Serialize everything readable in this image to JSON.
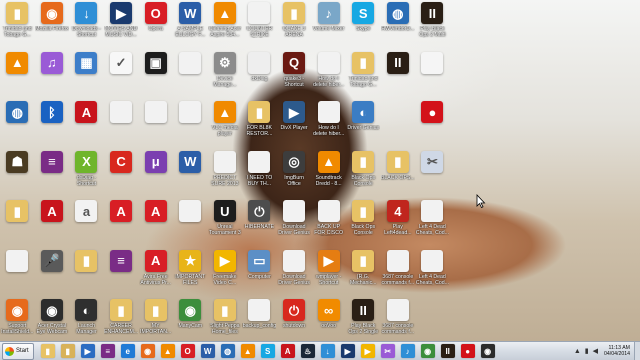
{
  "desktop": {
    "icons": [
      {
        "label": "Trinidad and Tobago G...",
        "icon": "folder-icon",
        "color": "#e7c265",
        "glyph": "▮"
      },
      {
        "label": "Mozilla Firefox",
        "icon": "firefox-icon",
        "color": "#e66a1c",
        "glyph": "◉"
      },
      {
        "label": "Downloads - Shortcut",
        "icon": "downloads-icon",
        "color": "#2f8fd6",
        "glyph": "↓"
      },
      {
        "label": "MOVIES AND MUSIC VID...",
        "icon": "media-center-icon",
        "color": "#1a3a6e",
        "glyph": "▶"
      },
      {
        "label": "Opera",
        "icon": "opera-icon",
        "color": "#d81e25",
        "glyph": "O"
      },
      {
        "label": "A SAMPLE EULOGY F...",
        "icon": "word-doc-icon",
        "color": "#2b5ea8",
        "glyph": "W"
      },
      {
        "label": "Cleaning Acer Aspire 534...",
        "icon": "vlc-icon",
        "color": "#f08a00",
        "glyph": "▲"
      },
      {
        "label": "COUNTER STRIKE GLO...",
        "icon": "file-icon",
        "color": "#f2f2f2",
        "glyph": ""
      },
      {
        "label": "QUAKE 3 ARENA",
        "icon": "folder-icon",
        "color": "#e7c265",
        "glyph": "▮"
      },
      {
        "label": "Volume Mixer",
        "icon": "volume-mixer-icon",
        "color": "#7aa7c8",
        "glyph": "♪"
      },
      {
        "label": "Skype",
        "icon": "skype-icon",
        "color": "#17a8e3",
        "glyph": "S"
      },
      {
        "label": "HWVendorD...",
        "icon": "globe-icon",
        "color": "#2a6db5",
        "glyph": "◍"
      },
      {
        "label": "Play Black Ops 2 Multi",
        "icon": "black-ops-icon",
        "color": "#2a1f15",
        "glyph": "II"
      },
      {
        "label": "",
        "icon": "",
        "color": "",
        "glyph": ""
      },
      {
        "label": "",
        "icon": "",
        "color": "",
        "glyph": ""
      },
      {
        "label": "",
        "icon": "vlc-icon",
        "color": "#f08a00",
        "glyph": "▲"
      },
      {
        "label": "",
        "icon": "itunes-icon",
        "color": "#9a5bd6",
        "glyph": "♫"
      },
      {
        "label": "",
        "icon": "control-panel-icon",
        "color": "#3d7ec9",
        "glyph": "▦"
      },
      {
        "label": "",
        "icon": "checkmark-icon",
        "color": "#f7f7f7",
        "glyph": "✓"
      },
      {
        "label": "",
        "icon": "app-icon",
        "color": "#1d1d1d",
        "glyph": "▣"
      },
      {
        "label": "",
        "icon": "file-icon",
        "color": "#f2f2f2",
        "glyph": ""
      },
      {
        "label": "Device Manage...",
        "icon": "device-manager-icon",
        "color": "#8c8c8c",
        "glyph": "⚙"
      },
      {
        "label": "dxDiag",
        "icon": "file-icon",
        "color": "#eeeeee",
        "glyph": ""
      },
      {
        "label": "quake3 - Shortcut",
        "icon": "quake-icon",
        "color": "#6b1a12",
        "glyph": "Q"
      },
      {
        "label": "How do I delete hiber...",
        "icon": "file-icon",
        "color": "#f2f2f2",
        "glyph": ""
      },
      {
        "label": "Trinidad and Tobago G...",
        "icon": "folder-icon",
        "color": "#e7c265",
        "glyph": "▮"
      },
      {
        "label": "",
        "icon": "black-ops-icon",
        "color": "#2a1f15",
        "glyph": "II"
      },
      {
        "label": "",
        "icon": "file-icon",
        "color": "#f5f5f5",
        "glyph": ""
      },
      {
        "label": "",
        "icon": "",
        "color": "",
        "glyph": ""
      },
      {
        "label": "",
        "icon": "",
        "color": "",
        "glyph": ""
      },
      {
        "label": "",
        "icon": "globe-icon",
        "color": "#2a6db5",
        "glyph": "◍"
      },
      {
        "label": "",
        "icon": "bluetooth-icon",
        "color": "#1a62c2",
        "glyph": "ᛒ"
      },
      {
        "label": "",
        "icon": "pdf-icon",
        "color": "#c8141c",
        "glyph": "A"
      },
      {
        "label": "",
        "icon": "file-icon",
        "color": "#f2f2f2",
        "glyph": ""
      },
      {
        "label": "",
        "icon": "file-icon",
        "color": "#f2f2f2",
        "glyph": ""
      },
      {
        "label": "",
        "icon": "file-icon",
        "color": "#f2f2f2",
        "glyph": ""
      },
      {
        "label": "VLC media player",
        "icon": "vlc-icon",
        "color": "#f08a00",
        "glyph": "▲"
      },
      {
        "label": "FOR BL8K RESTOR...",
        "icon": "folder-icon",
        "color": "#e7c265",
        "glyph": "▮"
      },
      {
        "label": "DivX Player",
        "icon": "divx-icon",
        "color": "#2d5a8c",
        "glyph": "▶"
      },
      {
        "label": "How do I delete hiber...",
        "icon": "file-icon",
        "color": "#f2f2f2",
        "glyph": ""
      },
      {
        "label": "Driver Genius",
        "icon": "driver-genius-icon",
        "color": "#3b7dc4",
        "glyph": "◐"
      },
      {
        "label": "",
        "icon": "",
        "color": "",
        "glyph": ""
      },
      {
        "label": "",
        "icon": "record-icon",
        "color": "#d3121a",
        "glyph": "●"
      },
      {
        "label": "",
        "icon": "",
        "color": "",
        "glyph": ""
      },
      {
        "label": "",
        "icon": "",
        "color": "",
        "glyph": ""
      },
      {
        "label": "",
        "icon": "game-icon",
        "color": "#4a3b22",
        "glyph": "☗"
      },
      {
        "label": "",
        "icon": "winrar-icon",
        "color": "#7a2c86",
        "glyph": "≡"
      },
      {
        "label": "dxDiag - Shortcut",
        "icon": "xbox-icon",
        "color": "#6fb52c",
        "glyph": "X"
      },
      {
        "label": "",
        "icon": "ccleaner-icon",
        "color": "#d8281e",
        "glyph": "C"
      },
      {
        "label": "",
        "icon": "bittorrent-icon",
        "color": "#7b3fb0",
        "glyph": "μ"
      },
      {
        "label": "",
        "icon": "word-doc-icon",
        "color": "#2b5ea8",
        "glyph": "W"
      },
      {
        "label": "PREDICT SURE 2013",
        "icon": "file-icon",
        "color": "#f2f2f2",
        "glyph": ""
      },
      {
        "label": "I NEED TO BUY TH...",
        "icon": "file-icon",
        "color": "#f2f2f2",
        "glyph": ""
      },
      {
        "label": "ImgBurn Office",
        "icon": "imgburn-icon",
        "color": "#3d3d3d",
        "glyph": "◎"
      },
      {
        "label": "Soundtrack Dredd - 8...",
        "icon": "vlc-icon",
        "color": "#f08a00",
        "glyph": "▲"
      },
      {
        "label": "Black Ops Console Che...",
        "icon": "folder-icon",
        "color": "#e7c265",
        "glyph": "▮"
      },
      {
        "label": "BLACK OPS...",
        "icon": "folder-icon",
        "color": "#e7c265",
        "glyph": "▮"
      },
      {
        "label": "",
        "icon": "snipping-tool-icon",
        "color": "#cfd8e6",
        "glyph": "✂"
      },
      {
        "label": "",
        "icon": "",
        "color": "",
        "glyph": ""
      },
      {
        "label": "",
        "icon": "",
        "color": "",
        "glyph": ""
      },
      {
        "label": "",
        "icon": "folder-icon",
        "color": "#e7c265",
        "glyph": "▮"
      },
      {
        "label": "",
        "icon": "pdf-icon",
        "color": "#c8141c",
        "glyph": "A"
      },
      {
        "label": "",
        "icon": "file-icon",
        "color": "#f2f2f2",
        "glyph": "a"
      },
      {
        "label": "",
        "icon": "avira-icon",
        "color": "#d81e25",
        "glyph": "A"
      },
      {
        "label": "",
        "icon": "avira-icon",
        "color": "#d81e25",
        "glyph": "A"
      },
      {
        "label": "",
        "icon": "file-icon",
        "color": "#f2f2f2",
        "glyph": ""
      },
      {
        "label": "Unreal Tournament 3",
        "icon": "unreal-icon",
        "color": "#1d1d1d",
        "glyph": "U"
      },
      {
        "label": "HIBERNATE",
        "icon": "power-icon",
        "color": "#4d4d4d",
        "glyph": "⏻"
      },
      {
        "label": "Download Driver Genius",
        "icon": "file-icon",
        "color": "#f2f2f2",
        "glyph": ""
      },
      {
        "label": "BACK UP FOR CISCO ROU...",
        "icon": "file-icon",
        "color": "#f2f2f2",
        "glyph": ""
      },
      {
        "label": "Black Ops Console Che...",
        "icon": "folder-icon",
        "color": "#e7c265",
        "glyph": "▮"
      },
      {
        "label": "Play Left4dead...",
        "icon": "left4dead-icon",
        "color": "#c0261e",
        "glyph": "4"
      },
      {
        "label": "Left 4 Dead Cheats, Cod...",
        "icon": "file-icon",
        "color": "#f2f2f2",
        "glyph": ""
      },
      {
        "label": "",
        "icon": "",
        "color": "",
        "glyph": ""
      },
      {
        "label": "",
        "icon": "",
        "color": "",
        "glyph": ""
      },
      {
        "label": "",
        "icon": "file-icon",
        "color": "#f2f2f2",
        "glyph": ""
      },
      {
        "label": "",
        "icon": "microphone-icon",
        "color": "#5a5a5a",
        "glyph": "🎤"
      },
      {
        "label": "",
        "icon": "folder-icon",
        "color": "#e7c265",
        "glyph": "▮"
      },
      {
        "label": "",
        "icon": "winrar-icon",
        "color": "#7a2c86",
        "glyph": "≡"
      },
      {
        "label": "Avira Free Antivirus Pr...",
        "icon": "avira-icon",
        "color": "#d81e25",
        "glyph": "A"
      },
      {
        "label": "IMPORTANT FILES",
        "icon": "star-icon",
        "color": "#e8b419",
        "glyph": "★"
      },
      {
        "label": "Freemake Video C...",
        "icon": "freemake-icon",
        "color": "#f2b600",
        "glyph": "▶"
      },
      {
        "label": "Computer",
        "icon": "computer-icon",
        "color": "#5c8fc6",
        "glyph": "▭"
      },
      {
        "label": "Download Driver Genius",
        "icon": "file-icon",
        "color": "#f2f2f2",
        "glyph": ""
      },
      {
        "label": "wmplayer - Shortcut",
        "icon": "wmplayer-icon",
        "color": "#e57d12",
        "glyph": "▶"
      },
      {
        "label": "[R.G. Mechanic...",
        "icon": "folder-icon",
        "color": "#e7c265",
        "glyph": "▮"
      },
      {
        "label": "3687 console commands f...",
        "icon": "file-icon",
        "color": "#f2f2f2",
        "glyph": ""
      },
      {
        "label": "Left 4 Dead Cheats, Cod...",
        "icon": "file-icon",
        "color": "#f2f2f2",
        "glyph": ""
      },
      {
        "label": "",
        "icon": "",
        "color": "",
        "glyph": ""
      },
      {
        "label": "",
        "icon": "",
        "color": "",
        "glyph": ""
      },
      {
        "label": "Support InstallShield...",
        "icon": "firefox-icon",
        "color": "#e66a1c",
        "glyph": "◉"
      },
      {
        "label": "Acer Crystal Eye Webcam",
        "icon": "webcam-icon",
        "color": "#2c2c2c",
        "glyph": "◉"
      },
      {
        "label": "Launch Manager",
        "icon": "launch-manager-icon",
        "color": "#2f2f2f",
        "glyph": "◐"
      },
      {
        "label": "CAREER ENHANCEM...",
        "icon": "folder-icon",
        "color": "#e7c265",
        "glyph": "▮"
      },
      {
        "label": "MY IMPORTAN...",
        "icon": "folder-icon",
        "color": "#e7c265",
        "glyph": "▮"
      },
      {
        "label": "ManyCam",
        "icon": "manycam-icon",
        "color": "#3c8e3c",
        "glyph": "◉"
      },
      {
        "label": "Slight Peppa Home_files",
        "icon": "folder-icon",
        "color": "#e7c265",
        "glyph": "▮"
      },
      {
        "label": "backup_config",
        "icon": "file-icon",
        "color": "#f2f2f2",
        "glyph": ""
      },
      {
        "label": "shutdown",
        "icon": "power-icon",
        "color": "#d8281e",
        "glyph": "⏻"
      },
      {
        "label": "ooVoo",
        "icon": "oovoo-icon",
        "color": "#f18b00",
        "glyph": "∞"
      },
      {
        "label": "Play Black Ops 2 Single",
        "icon": "black-ops-icon",
        "color": "#2a1f15",
        "glyph": "II"
      },
      {
        "label": "3687 console commands f...",
        "icon": "file-icon",
        "color": "#f2f2f2",
        "glyph": ""
      },
      {
        "label": "",
        "icon": "",
        "color": "",
        "glyph": ""
      },
      {
        "label": "",
        "icon": "",
        "color": "",
        "glyph": ""
      },
      {
        "label": "",
        "icon": "",
        "color": "",
        "glyph": ""
      }
    ]
  },
  "taskbar": {
    "start_label": "Start",
    "pinned": [
      {
        "icon": "explorer-icon",
        "color": "#e7c265",
        "glyph": "▮"
      },
      {
        "icon": "folder-icon",
        "color": "#d8b25a",
        "glyph": "▮"
      },
      {
        "icon": "media-player-icon",
        "color": "#2b6cc2",
        "glyph": "▶"
      },
      {
        "icon": "winrar-icon",
        "color": "#7a2c86",
        "glyph": "≡"
      },
      {
        "icon": "ie-icon",
        "color": "#1f7ad6",
        "glyph": "e"
      },
      {
        "icon": "firefox-icon",
        "color": "#e66a1c",
        "glyph": "◉"
      },
      {
        "icon": "vlc-icon",
        "color": "#f08a00",
        "glyph": "▲"
      },
      {
        "icon": "opera-icon",
        "color": "#d81e25",
        "glyph": "O"
      },
      {
        "icon": "word-icon",
        "color": "#2b5ea8",
        "glyph": "W"
      },
      {
        "icon": "globe-icon",
        "color": "#2a6db5",
        "glyph": "◍"
      },
      {
        "icon": "vlc-icon",
        "color": "#f08a00",
        "glyph": "▲"
      },
      {
        "icon": "skype-icon",
        "color": "#17a8e3",
        "glyph": "S"
      },
      {
        "icon": "pdf-icon",
        "color": "#c8141c",
        "glyph": "A"
      },
      {
        "icon": "steam-icon",
        "color": "#1b2838",
        "glyph": "♨"
      },
      {
        "icon": "downloads-icon",
        "color": "#2f8fd6",
        "glyph": "↓"
      },
      {
        "icon": "media-center-icon",
        "color": "#1a3a6e",
        "glyph": "▶"
      },
      {
        "icon": "freemake-icon",
        "color": "#f2b600",
        "glyph": "▶"
      },
      {
        "icon": "snipping-tool-icon",
        "color": "#9a5bd6",
        "glyph": "✂"
      },
      {
        "icon": "music-icon",
        "color": "#2f8fd6",
        "glyph": "♪"
      },
      {
        "icon": "manycam-icon",
        "color": "#3c8e3c",
        "glyph": "◉"
      },
      {
        "icon": "black-ops-icon",
        "color": "#2a1f15",
        "glyph": "II"
      },
      {
        "icon": "record-icon",
        "color": "#d3121a",
        "glyph": "●"
      },
      {
        "icon": "webcam-icon",
        "color": "#2c2c2c",
        "glyph": "◉"
      }
    ],
    "clock_time": "11:13 AM",
    "clock_date": "04/04/2014"
  }
}
